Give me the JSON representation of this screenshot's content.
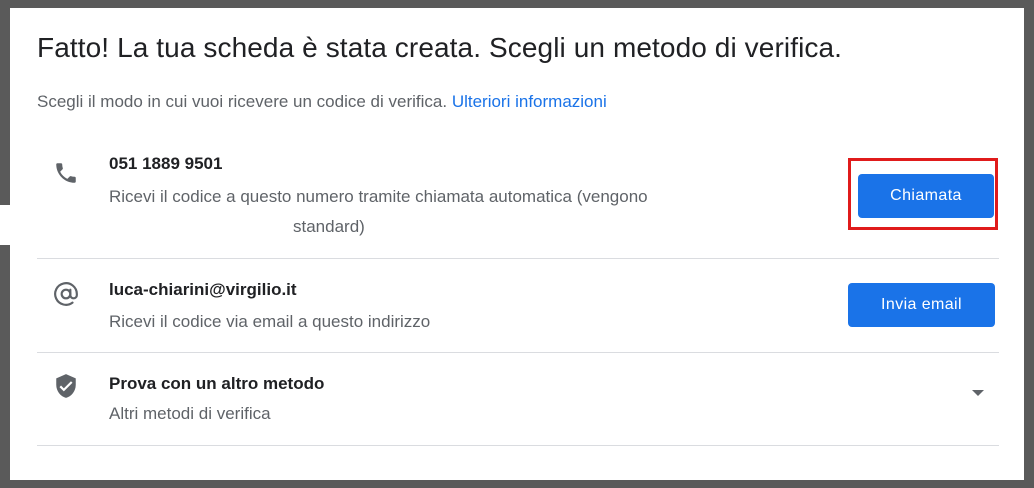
{
  "header": {
    "title": "Fatto! La tua scheda è stata creata. Scegli un metodo di verifica.",
    "subtitle": "Scegli il modo in cui vuoi ricevere un codice di verifica.",
    "learn_more": "Ulteriori informazioni"
  },
  "options": [
    {
      "icon": "phone-icon",
      "title": "051 1889 9501",
      "desc_line1": "Ricevi il codice a questo numero tramite chiamata automatica (vengono",
      "desc_line2": "standard)",
      "button_label": "Chiamata"
    },
    {
      "icon": "at-sign-icon",
      "title": "luca-chiarini@virgilio.it",
      "desc_line1": "Ricevi il codice via email a questo indirizzo",
      "button_label": "Invia email"
    },
    {
      "icon": "shield-check-icon",
      "title": "Prova con un altro metodo",
      "desc_line1": "Altri metodi di verifica",
      "expand_icon": "chevron-down-icon"
    }
  ],
  "colors": {
    "accent": "#1a73e8",
    "highlight": "#e01b1b",
    "frame": "#5a5a5a"
  }
}
